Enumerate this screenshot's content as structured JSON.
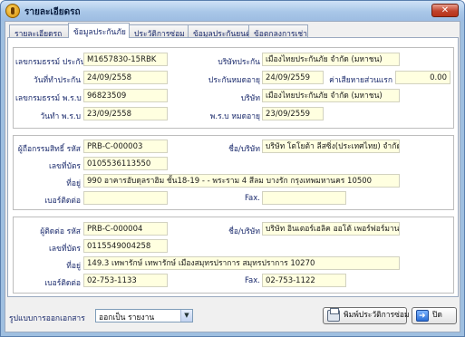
{
  "window": {
    "title": "รายละเอียดรถ",
    "close_glyph": "✕"
  },
  "tabs": [
    {
      "label": "รายละเอียดรถ",
      "active": false
    },
    {
      "label": "ข้อมูลประกันภัย",
      "active": true
    },
    {
      "label": "ประวัติการซ่อม",
      "active": false
    },
    {
      "label": "ข้อมูลประกันยนต์",
      "active": false
    },
    {
      "label": "ข้อตกลงการเช่า",
      "active": false
    }
  ],
  "policy": {
    "policy_no_label": "เลขกรมธรรม์ ประกัน",
    "policy_no": "M1657830-15RBK",
    "insurer_label": "บริษัทประกัน",
    "insurer": "เมืองไทยประกันภัย จำกัด (มหาชน)",
    "start_date_label": "วันที่ทำประกัน",
    "start_date": "24/09/2558",
    "expiry_label": "ประกันหมดอายุ",
    "expiry": "24/09/2559",
    "deductible_label": "ค่าเสียหายส่วนแรก",
    "deductible": "0.00",
    "prb_no_label": "เลขกรมธรรม์ พ.ร.บ",
    "prb_no": "96823509",
    "prb_company_label": "บริษัท",
    "prb_company": "เมืองไทยประกันภัย จำกัด (มหาชน)",
    "prb_date_label": "วันทำ พ.ร.บ",
    "prb_date": "23/09/2558",
    "prb_expiry_label": "พ.ร.บ หมดอายุ",
    "prb_expiry": "23/09/2559"
  },
  "beneficiary": {
    "code_label": "ผู้ถือกรรมสิทธิ์ รหัส",
    "code": "PRB-C-000003",
    "name_label": "ชื่อ/บริษัท",
    "name": "บริษัท โตโยต้า ลีสซิ่ง(ประเทศไทย) จำกัด",
    "tax_label": "เลขที่บัตร",
    "tax_id": "0105536113550",
    "address_label": "ที่อยู่",
    "address": "990 อาคารอับดุลราฮิม ชั้น18-19 - - พระราม 4 สีลม บางรัก กรุงเทพมหานคร 10500",
    "phone_label": "เบอร์ติดต่อ",
    "phone": "",
    "fax_label": "Fax.",
    "fax": ""
  },
  "renter": {
    "code_label": "ผู้ติดต่อ รหัส",
    "code": "PRB-C-000004",
    "name_label": "ชื่อ/บริษัท",
    "name": "บริษัท อินเตอร์เฮลิค ออโต้ เพอร์ฟอร์มานซ์ จำกัด",
    "tax_label": "เลขที่บัตร",
    "tax_id": "0115549004258",
    "address_label": "ที่อยู่",
    "address": "149.3 เทพารักษ์ เทพารักษ์ เมืองสมุทรปราการ สมุทรปราการ 10270",
    "phone_label": "เบอร์ติดต่อ",
    "phone": "02-753-1133",
    "fax_label": "Fax.",
    "fax": "02-753-1122"
  },
  "footer": {
    "doc_format_label": "รูปแบบการออกเอกสาร",
    "doc_format_value": "ออกเป็น รายงาน",
    "print_label": "พิมพ์ประวัติการซ่อม",
    "close_label": "ปิด"
  },
  "icons": {
    "app": "coin-icon",
    "print": "printer-icon",
    "close": "exit-icon"
  }
}
